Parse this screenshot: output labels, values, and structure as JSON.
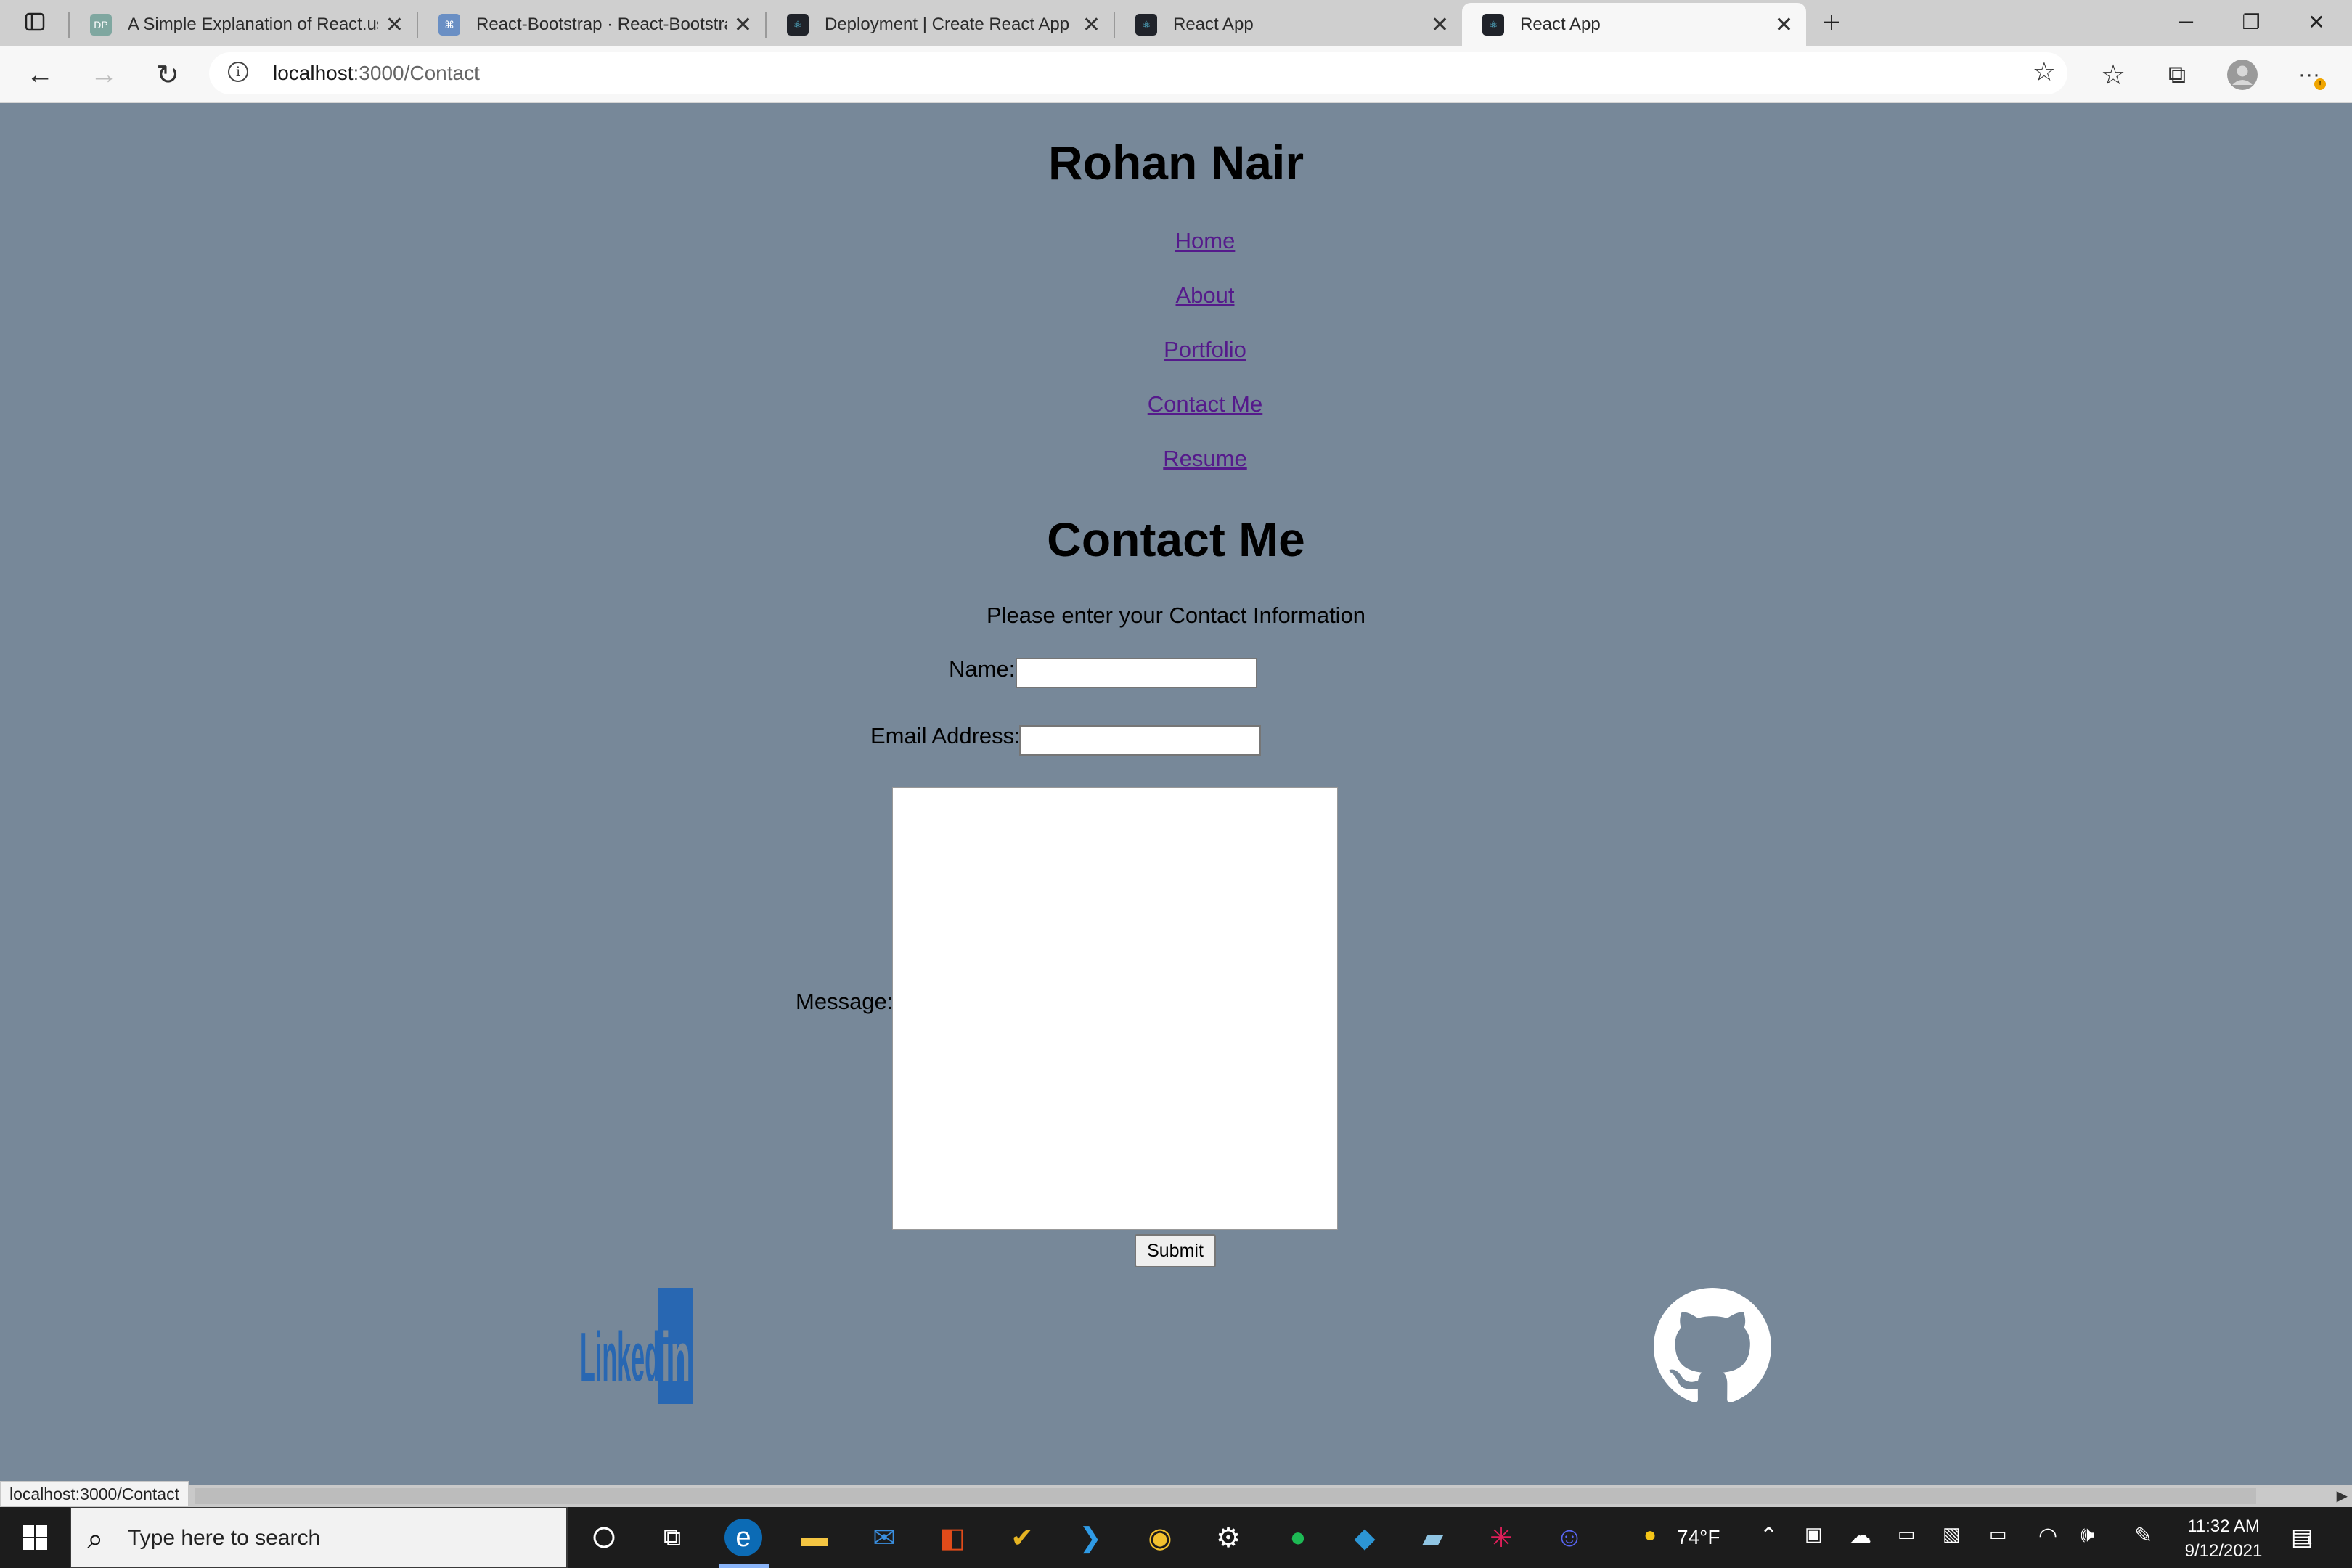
{
  "browser": {
    "tabs": [
      {
        "title": "A Simple Explanation of React.us",
        "favicon": "dp-favicon",
        "favicon_text": "DP",
        "favicon_color": "#7fa7a0"
      },
      {
        "title": "React-Bootstrap · React-Bootstra",
        "favicon": "react-bootstrap-favicon",
        "favicon_color": "#6a8fc4"
      },
      {
        "title": "Deployment | Create React App",
        "favicon": "react-favicon",
        "favicon_color": "#20232a"
      },
      {
        "title": "React App",
        "favicon": "react-favicon",
        "favicon_color": "#20232a"
      },
      {
        "title": "React App",
        "favicon": "react-favicon",
        "favicon_color": "#20232a",
        "active": true
      }
    ],
    "address": {
      "host": "localhost",
      "path": ":3000/Contact"
    },
    "status_url": "localhost:3000/Contact"
  },
  "page": {
    "site_title": "Rohan Nair",
    "nav": [
      "Home",
      "About",
      "Portfolio",
      "Contact Me",
      "Resume"
    ],
    "contact_heading": "Contact Me",
    "subtitle": "Please enter your Contact Information",
    "form": {
      "name_label": "Name:",
      "email_label": "Email Address:",
      "message_label": "Message:",
      "submit_label": "Submit",
      "name_value": "",
      "email_value": "",
      "message_value": ""
    },
    "social": {
      "linkedin_text": "Linked",
      "linkedin_in": "in",
      "linkedin_color": "#2867b2",
      "github_icon": "github-icon"
    },
    "background_color": "#778899",
    "link_color": "#551a8b"
  },
  "taskbar": {
    "search_placeholder": "Type here to search",
    "weather": "74°F",
    "time": "11:32 AM",
    "date": "9/12/2021",
    "notification_count": "1"
  }
}
